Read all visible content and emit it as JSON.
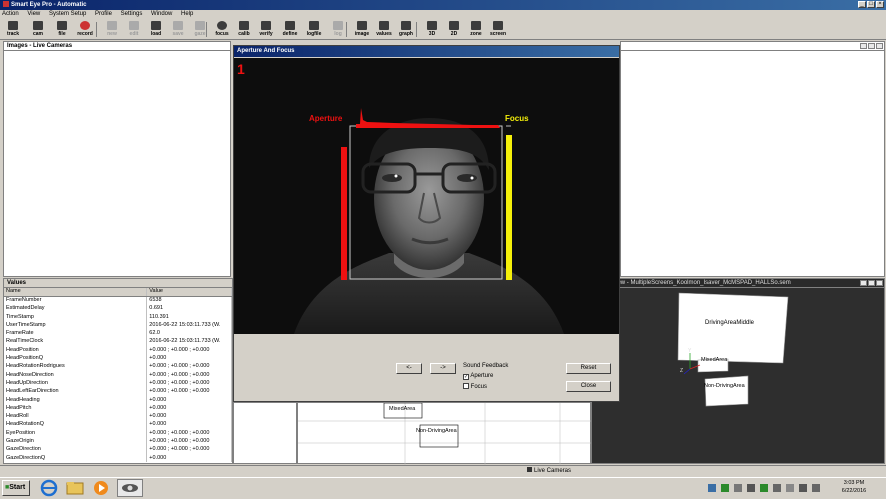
{
  "app": {
    "title": "Smart Eye Pro - Automatic",
    "menu": [
      "Action",
      "View",
      "System Setup",
      "Profile",
      "Settings",
      "Window",
      "Help"
    ],
    "toolbar": [
      {
        "label": "track",
        "icon": "track-icon",
        "enabled": true
      },
      {
        "label": "cam",
        "icon": "camera-icon",
        "enabled": true
      },
      {
        "label": "file",
        "icon": "file-icon",
        "enabled": true
      },
      {
        "label": "record",
        "icon": "record-icon",
        "enabled": true
      },
      {
        "label": "new",
        "icon": "new-icon",
        "enabled": false
      },
      {
        "label": "edit",
        "icon": "edit-icon",
        "enabled": false
      },
      {
        "label": "load",
        "icon": "load-icon",
        "enabled": true
      },
      {
        "label": "save",
        "icon": "save-icon",
        "enabled": false
      },
      {
        "label": "gaze",
        "icon": "gaze-icon",
        "enabled": false
      },
      {
        "label": "focus",
        "icon": "focus-icon",
        "enabled": true
      },
      {
        "label": "calib",
        "icon": "calib-icon",
        "enabled": true
      },
      {
        "label": "verify",
        "icon": "verify-icon",
        "enabled": true
      },
      {
        "label": "define",
        "icon": "define-icon",
        "enabled": true
      },
      {
        "label": "logfile",
        "icon": "logfile-icon",
        "enabled": true
      },
      {
        "label": "log",
        "icon": "log-icon",
        "enabled": false
      },
      {
        "label": "image",
        "icon": "image-icon",
        "enabled": true
      },
      {
        "label": "values",
        "icon": "values-icon",
        "enabled": true
      },
      {
        "label": "graph",
        "icon": "graph-icon",
        "enabled": true
      },
      {
        "label": "3D",
        "icon": "3d-icon",
        "enabled": true
      },
      {
        "label": "2D",
        "icon": "2d-icon",
        "enabled": true
      },
      {
        "label": "zone",
        "icon": "zone-icon",
        "enabled": true
      },
      {
        "label": "screen",
        "icon": "screen-icon",
        "enabled": true
      }
    ]
  },
  "images_pane": {
    "title": "Images - Live Cameras"
  },
  "values_pane": {
    "title": "Values",
    "columns": [
      "Name",
      "Value"
    ],
    "rows": [
      [
        "FrameNumber",
        "6538"
      ],
      [
        "EstimatedDelay",
        "0.691"
      ],
      [
        "TimeStamp",
        "110.391"
      ],
      [
        "UserTimeStamp",
        "2016-06-22 15:03:11.733 (W."
      ],
      [
        "FrameRate",
        "62.0"
      ],
      [
        "RealTimeClock",
        "2016-06-22 15:03:11.733 (W."
      ],
      [
        "HeadPosition",
        "+0.000 ; +0.000 ; +0.000"
      ],
      [
        "HeadPositionQ",
        "+0.000"
      ],
      [
        "HeadRotationRodrigues",
        "+0.000 ; +0.000 ; +0.000"
      ],
      [
        "HeadNoseDirection",
        "+0.000 ; +0.000 ; +0.000"
      ],
      [
        "HeadUpDirection",
        "+0.000 ; +0.000 ; +0.000"
      ],
      [
        "HeadLeftEarDirection",
        "+0.000 ; +0.000 ; +0.000"
      ],
      [
        "HeadHeading",
        "+0.000"
      ],
      [
        "HeadPitch",
        "+0.000"
      ],
      [
        "HeadRoll",
        "+0.000"
      ],
      [
        "HeadRotationQ",
        "+0.000"
      ],
      [
        "EyePosition",
        "+0.000 ; +0.000 ; +0.000"
      ],
      [
        "GazeOrigin",
        "+0.000 ; +0.000 ; +0.000"
      ],
      [
        "GazeDirection",
        "+0.000 ; +0.000 ; +0.000"
      ],
      [
        "GazeDirectionQ",
        "+0.000"
      ]
    ]
  },
  "world_view": {
    "title": "World View - MultipleScreens_Koolmon_Isaver_McMSPAD_HALLSo.sem",
    "areas": [
      "DrivingAreaMiddle",
      "MixedArea",
      "Non-DrivingArea"
    ],
    "axis_labels": [
      "Y",
      "Z"
    ]
  },
  "lower_view": {
    "areas": [
      "MixedArea",
      "Non-DrivingArea"
    ]
  },
  "dialog": {
    "title": "Aperture And Focus",
    "camera_number": "1",
    "aperture_label": "Aperture",
    "focus_label": "Focus",
    "aperture_color": "#ee1111",
    "focus_color": "#f5f00a",
    "prev_button": "<-",
    "next_button": "->",
    "sound_feedback_label": "Sound Feedback",
    "aperture_check": {
      "label": "Aperture",
      "checked": true
    },
    "focus_check": {
      "label": "Focus",
      "checked": false
    },
    "reset_button": "Reset",
    "close_button": "Close"
  },
  "statusbar": {
    "text": "Live Cameras"
  },
  "taskbar": {
    "start_label": "Start",
    "clock_time": "3:03 PM",
    "clock_date": "6/22/2016"
  }
}
